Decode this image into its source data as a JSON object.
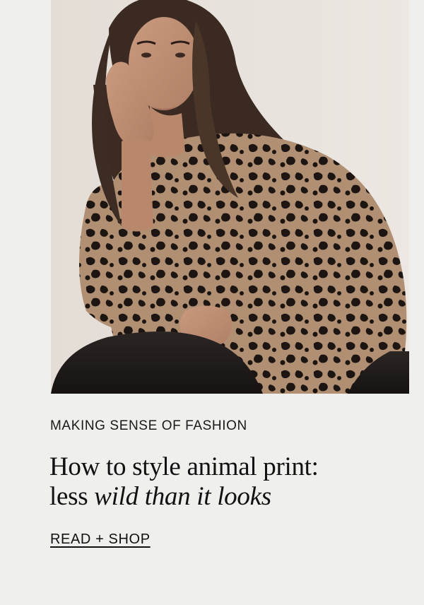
{
  "hero": {
    "image_alt": "Model wearing a leopard print knit sweater",
    "icon": "photo"
  },
  "article": {
    "eyebrow": "MAKING SENSE OF FASHION",
    "headline_line1": "How to style animal print:",
    "headline_line2_plain": "less ",
    "headline_line2_italic": "wild than it looks"
  },
  "cta": {
    "label": "READ + SHOP"
  },
  "colors": {
    "background": "#efefed",
    "text": "#111111"
  }
}
